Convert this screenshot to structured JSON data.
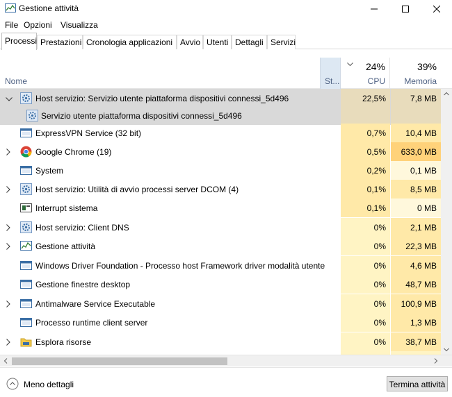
{
  "window": {
    "title": "Gestione attività",
    "app_icon": "task-manager-icon",
    "controls": [
      "minimize-icon",
      "maximize-icon",
      "close-icon"
    ]
  },
  "menu": [
    "File",
    "Opzioni",
    "Visualizza"
  ],
  "tabs": [
    "Processi",
    "Prestazioni",
    "Cronologia applicazioni",
    "Avvio",
    "Utenti",
    "Dettagli",
    "Servizi"
  ],
  "active_tab": "Processi",
  "columns": {
    "name": "Nome",
    "status": "St...",
    "cpu": {
      "label": "CPU",
      "total": "24%"
    },
    "memory": {
      "label": "Memoria",
      "total": "39%"
    }
  },
  "colors": {
    "selected_row": "#d9d9d9",
    "heat_low": "#fff4c4",
    "heat_mid": "#ffe9a8",
    "heat_high": "#ffd27a",
    "heat_zero": "#fff8dc",
    "header_text": "#4d6082"
  },
  "processes": [
    {
      "name": "Host servizio: Servizio utente piattaforma dispositivi connessi_5d496",
      "icon": "gear-icon",
      "expanded": true,
      "selected": true,
      "cpu": "22,5%",
      "memory": "7,8 MB"
    },
    {
      "name": "Servizio utente piattaforma dispositivi connessi_5d496",
      "icon": "service-gear-icon",
      "child": true,
      "selected": true,
      "cpu": "",
      "memory": ""
    },
    {
      "name": "ExpressVPN Service (32 bit)",
      "icon": "app-window-icon",
      "cpu": "0,7%",
      "memory": "10,4 MB"
    },
    {
      "name": "Google Chrome (19)",
      "icon": "chrome-icon",
      "expandable": true,
      "cpu": "0,5%",
      "memory": "633,0 MB"
    },
    {
      "name": "System",
      "icon": "app-window-icon",
      "cpu": "0,2%",
      "memory": "0,1 MB"
    },
    {
      "name": "Host servizio: Utilità di avvio processi server DCOM (4)",
      "icon": "gear-icon",
      "expandable": true,
      "cpu": "0,1%",
      "memory": "8,5 MB"
    },
    {
      "name": "Interrupt sistema",
      "icon": "cpu-chip-icon",
      "cpu": "0,1%",
      "memory": "0 MB"
    },
    {
      "name": "Host servizio: Client DNS",
      "icon": "gear-icon",
      "expandable": true,
      "cpu": "0%",
      "memory": "2,1 MB"
    },
    {
      "name": "Gestione attività",
      "icon": "task-manager-icon",
      "expandable": true,
      "cpu": "0%",
      "memory": "22,3 MB"
    },
    {
      "name": "Windows Driver Foundation - Processo host Framework driver modalità utente",
      "icon": "app-window-icon",
      "cpu": "0%",
      "memory": "4,6 MB"
    },
    {
      "name": "Gestione finestre desktop",
      "icon": "app-window-icon",
      "cpu": "0%",
      "memory": "48,7 MB"
    },
    {
      "name": "Antimalware Service Executable",
      "icon": "app-window-icon",
      "expandable": true,
      "cpu": "0%",
      "memory": "100,9 MB"
    },
    {
      "name": "Processo runtime client server",
      "icon": "app-window-icon",
      "cpu": "0%",
      "memory": "1,3 MB"
    },
    {
      "name": "Esplora risorse",
      "icon": "folder-icon",
      "expandable": true,
      "cpu": "0%",
      "memory": "38,7 MB"
    }
  ],
  "footer": {
    "fewer_details": "Meno dettagli",
    "end_task": "Termina attività"
  }
}
